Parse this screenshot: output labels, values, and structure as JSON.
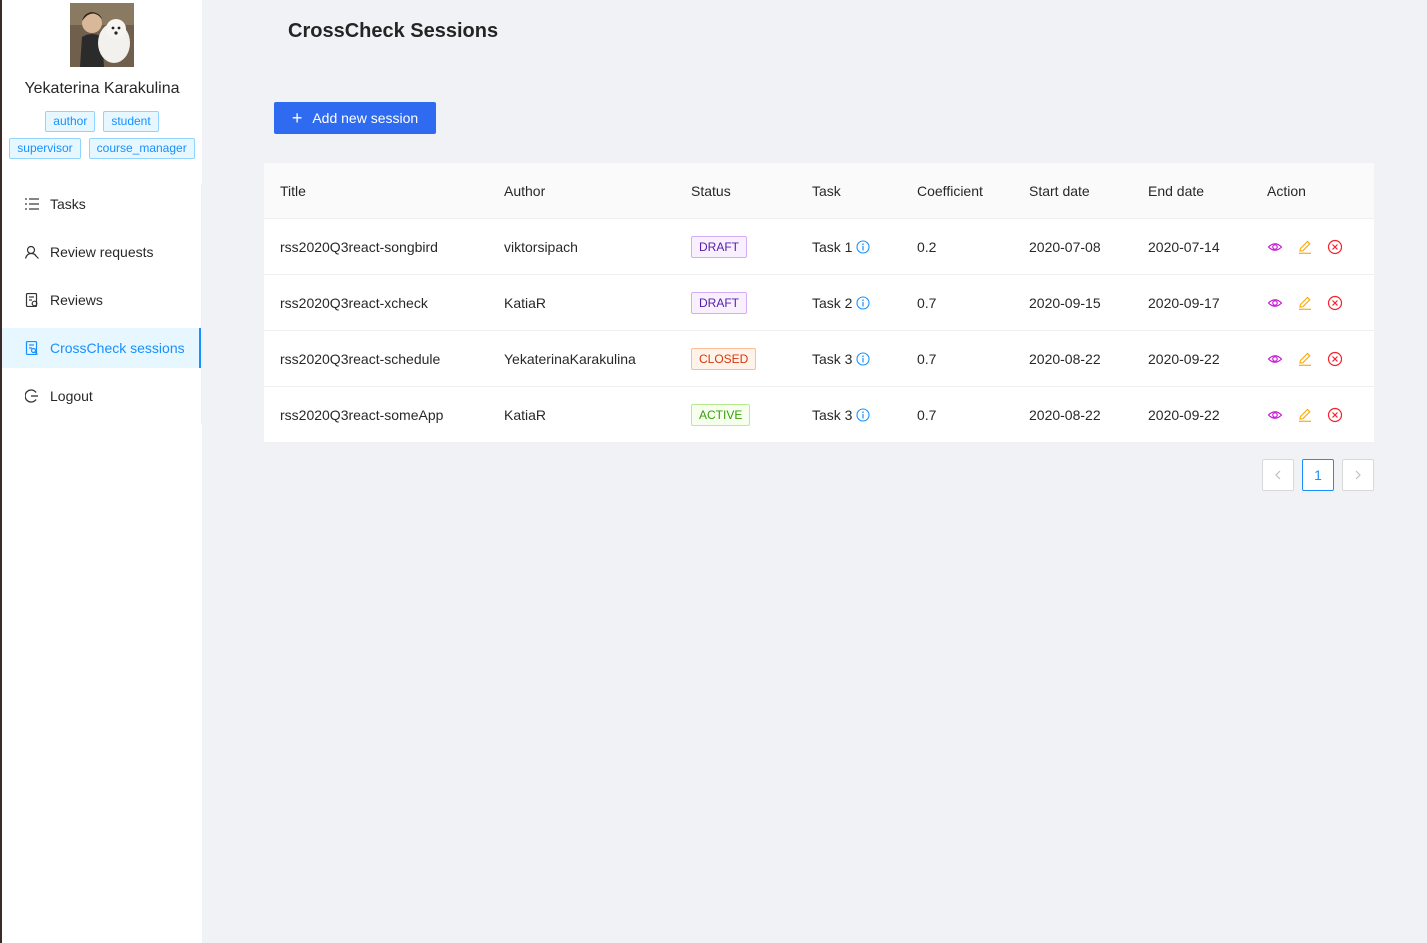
{
  "user": {
    "name": "Yekaterina Karakulina",
    "roles": [
      "author",
      "student",
      "supervisor",
      "course_manager"
    ]
  },
  "menu": {
    "items": [
      {
        "label": "Tasks",
        "icon": "list-icon"
      },
      {
        "label": "Review requests",
        "icon": "user-search-icon"
      },
      {
        "label": "Reviews",
        "icon": "document-check-icon"
      },
      {
        "label": "CrossCheck sessions",
        "icon": "document-search-icon"
      },
      {
        "label": "Logout",
        "icon": "logout-icon"
      }
    ],
    "active": "CrossCheck sessions"
  },
  "page": {
    "title": "CrossCheck Sessions",
    "add_button": "Add new session"
  },
  "table": {
    "columns": [
      "Title",
      "Author",
      "Status",
      "Task",
      "Coefficient",
      "Start date",
      "End date",
      "Action"
    ],
    "rows": [
      {
        "title": "rss2020Q3react-songbird",
        "author": "viktorsipach",
        "status": "DRAFT",
        "task": "Task 1",
        "coefficient": "0.2",
        "start": "2020-07-08",
        "end": "2020-07-14"
      },
      {
        "title": "rss2020Q3react-xcheck",
        "author": "KatiaR",
        "status": "DRAFT",
        "task": "Task 2",
        "coefficient": "0.7",
        "start": "2020-09-15",
        "end": "2020-09-17"
      },
      {
        "title": "rss2020Q3react-schedule",
        "author": "YekaterinaKarakulina",
        "status": "CLOSED",
        "task": "Task 3",
        "coefficient": "0.7",
        "start": "2020-08-22",
        "end": "2020-09-22"
      },
      {
        "title": "rss2020Q3react-someApp",
        "author": "KatiaR",
        "status": "ACTIVE",
        "task": "Task 3",
        "coefficient": "0.7",
        "start": "2020-08-22",
        "end": "2020-09-22"
      }
    ]
  },
  "pagination": {
    "current": "1",
    "prev_icon": "chevron-left-icon",
    "next_icon": "chevron-right-icon"
  },
  "colors": {
    "primary": "#2f6bf0",
    "link": "#1890ff",
    "view": "#c41dd4",
    "edit": "#faad14",
    "delete": "#f5222d"
  }
}
